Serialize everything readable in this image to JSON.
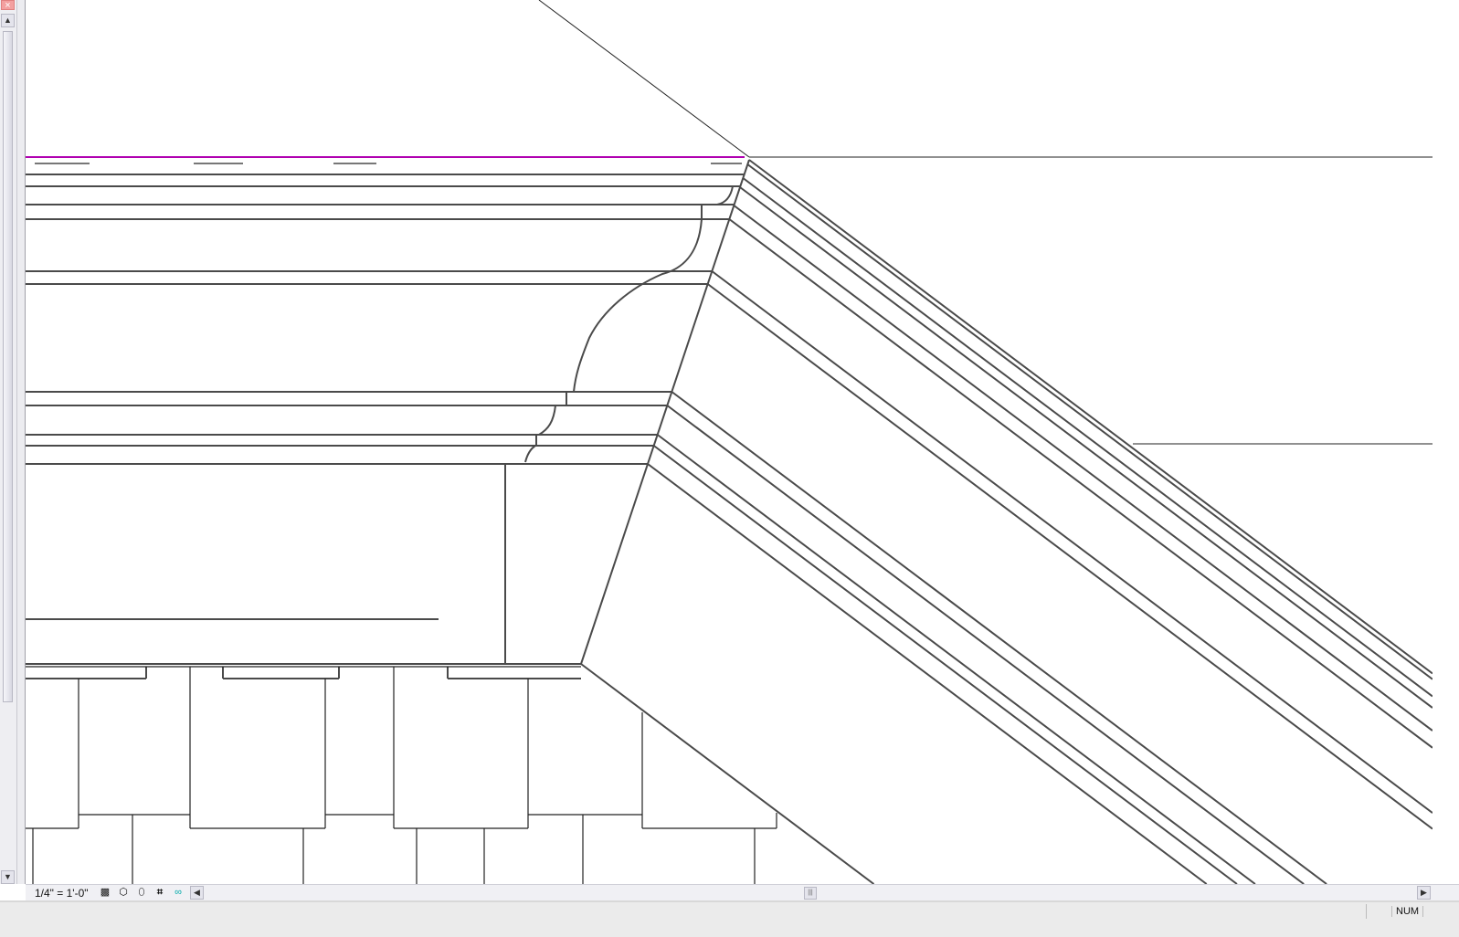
{
  "view": {
    "scale_label": "1/4\" = 1'-0\"",
    "view_control_icons": [
      "detail-level-icon",
      "model-graphics-style-icon",
      "shadows-icon",
      "crop-region-icon",
      "reveal-hidden-icon"
    ]
  },
  "status_bar": {
    "num_indicator": "NUM"
  },
  "window": {
    "close_glyph": "×"
  },
  "colors": {
    "line": "#4a4a4a",
    "magenta": "#b000b0"
  }
}
